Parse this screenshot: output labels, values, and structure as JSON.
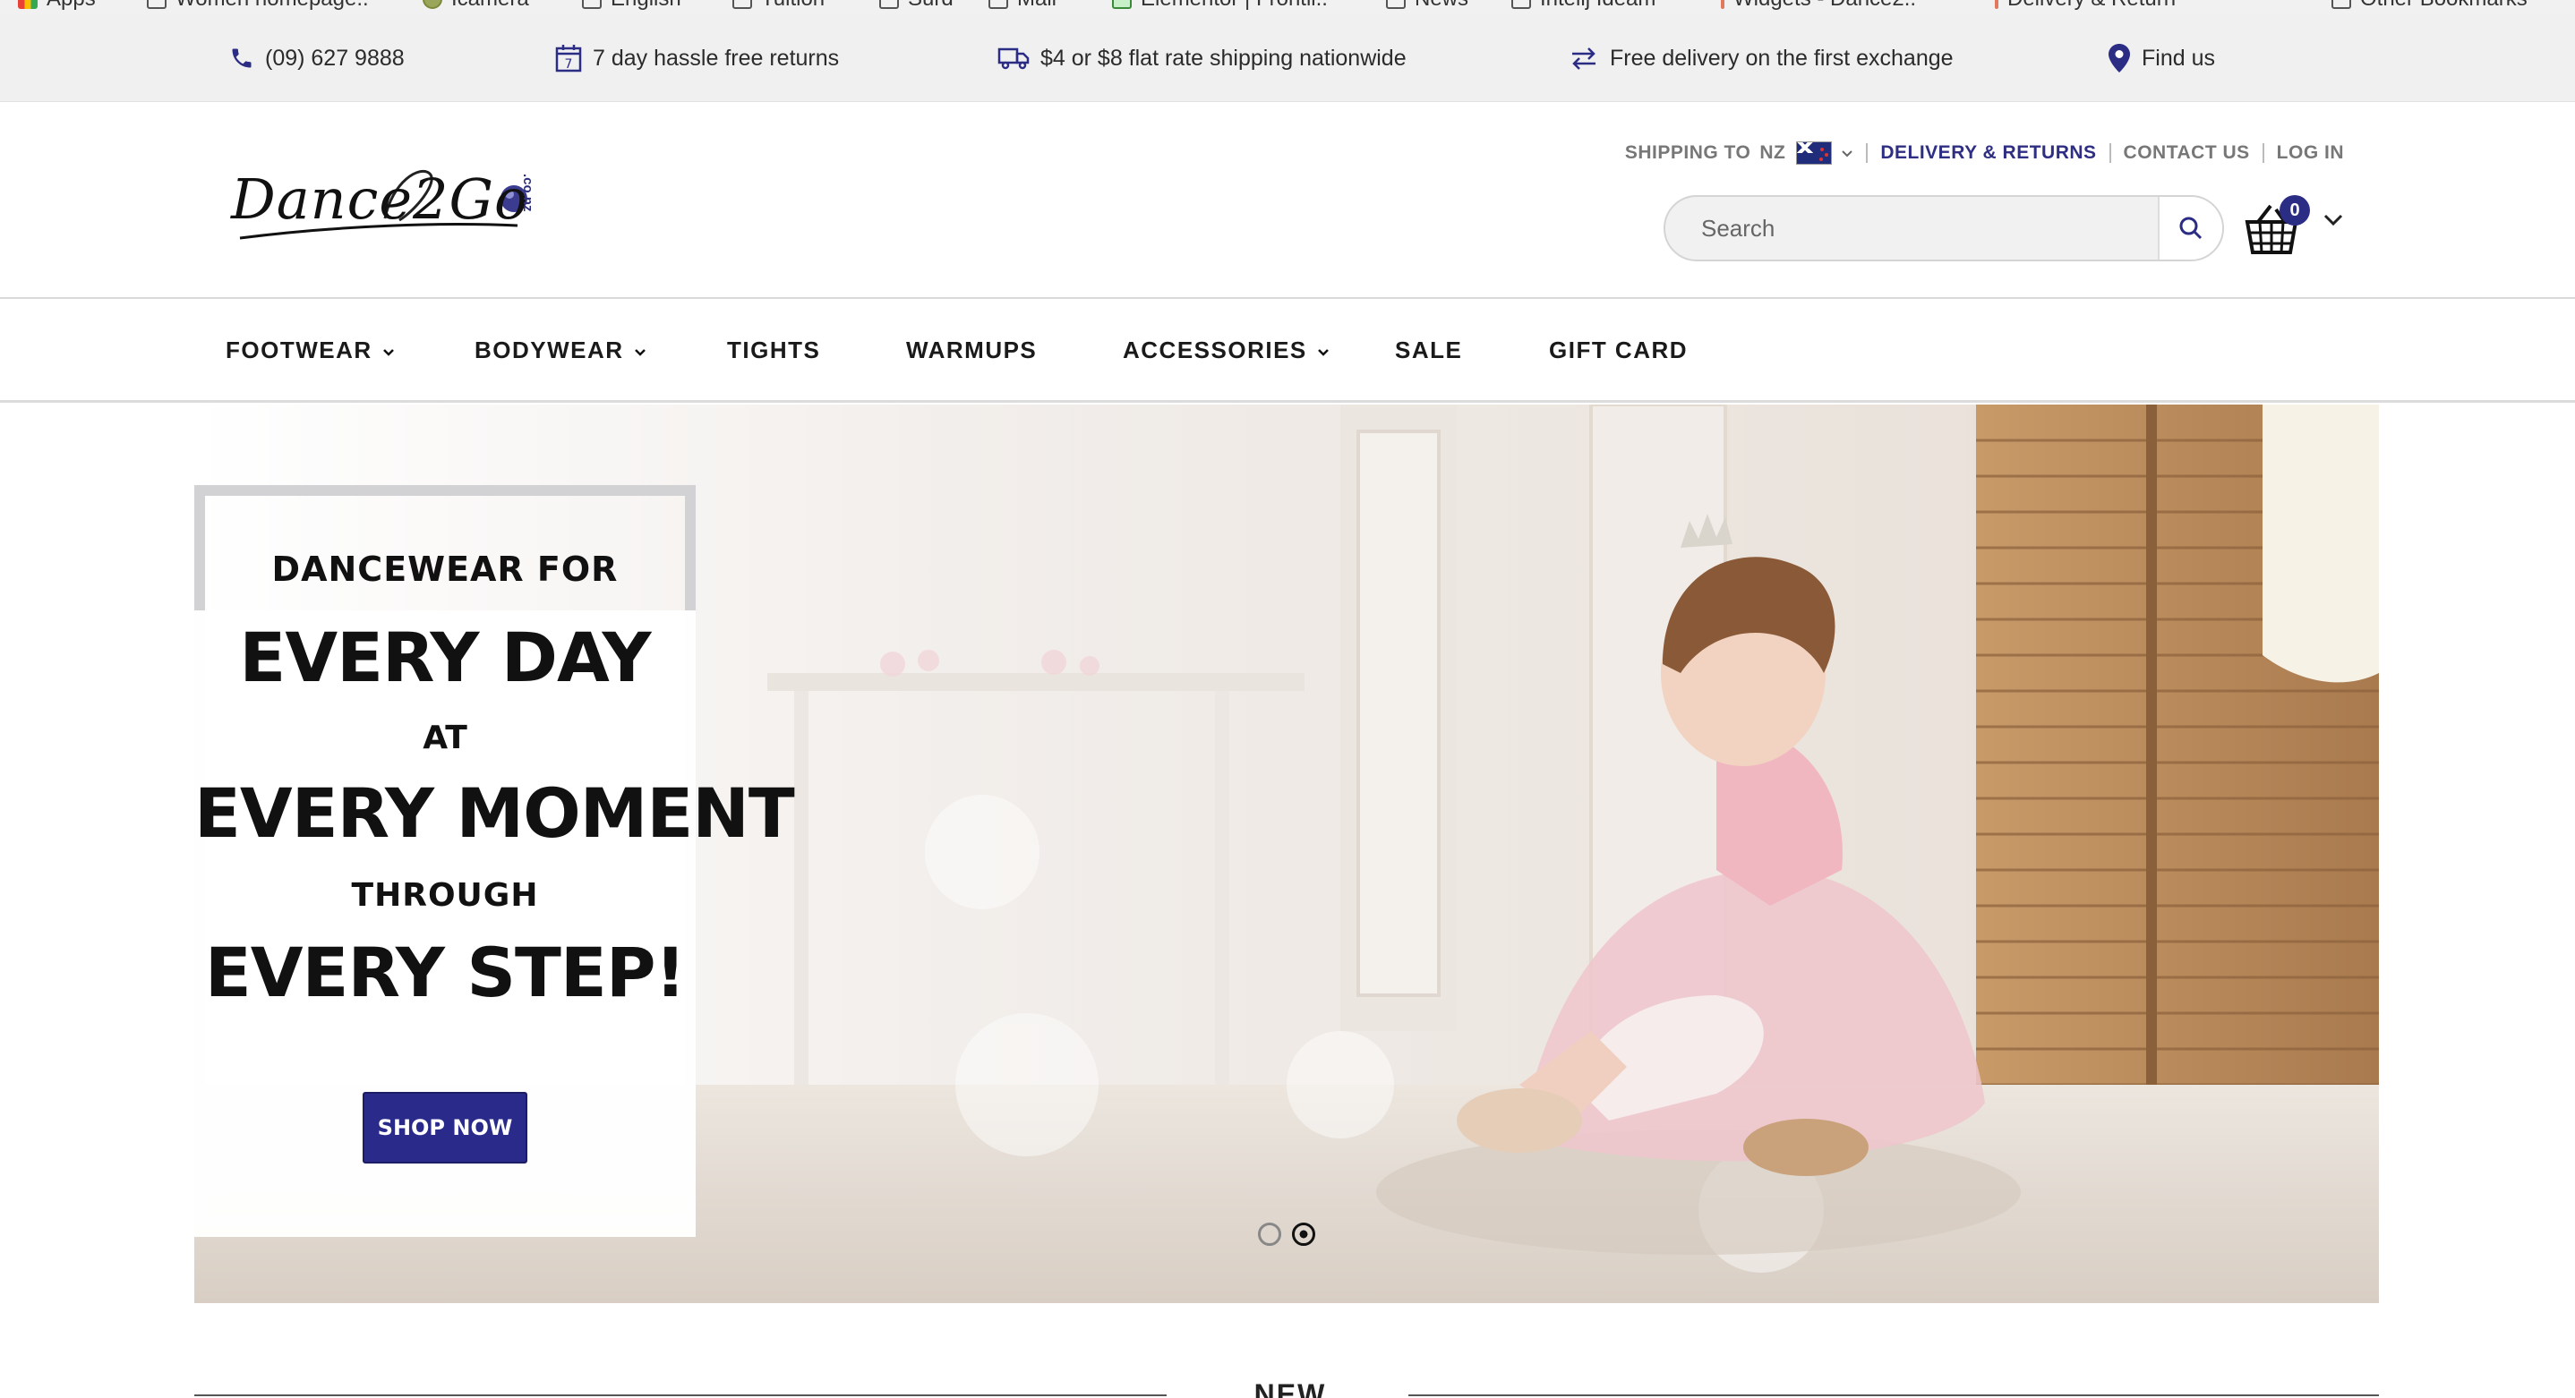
{
  "bookmarks": [
    {
      "label": "Apps",
      "icon": "apps-icon"
    },
    {
      "label": "Women homepage..",
      "icon": "page-icon"
    },
    {
      "label": "Icamera",
      "icon": "globe-icon"
    },
    {
      "label": "English",
      "icon": "folder-icon"
    },
    {
      "label": "Tuition",
      "icon": "folder-icon"
    },
    {
      "label": "Surd",
      "icon": "folder-icon"
    },
    {
      "label": "Mail",
      "icon": "folder-icon"
    },
    {
      "label": "Elementor | Frontli..",
      "icon": "elementor-icon"
    },
    {
      "label": "News",
      "icon": "folder-icon"
    },
    {
      "label": "Intelij Ideam",
      "icon": "folder-icon"
    },
    {
      "label": "Widgets - Dance2..",
      "icon": "site-icon"
    },
    {
      "label": "Delivery & Return",
      "icon": "site-icon"
    },
    {
      "label": "Other Bookmarks",
      "icon": "folder-icon"
    }
  ],
  "announcements": {
    "phone": "(09) 627 9888",
    "returns": "7 day hassle free returns",
    "shipping": "$4 or $8 flat rate shipping nationwide",
    "exchange": "Free delivery on the first exchange",
    "find_us": "Find us"
  },
  "header": {
    "logo_text": "Dance2Go",
    "logo_tld": ".co.nz",
    "shipping_to_label": "SHIPPING TO",
    "country": "NZ",
    "delivery_returns": "DELIVERY & RETURNS",
    "contact_us": "CONTACT US",
    "log_in": "LOG IN",
    "search_placeholder": "Search",
    "cart_count": "0"
  },
  "nav": {
    "footwear": "FOOTWEAR",
    "bodywear": "BODYWEAR",
    "tights": "TIGHTS",
    "warmups": "WARMUPS",
    "accessories": "ACCESSORIES",
    "sale": "SALE",
    "gift_card": "GIFT CARD"
  },
  "hero": {
    "line1": "DANCEWEAR FOR",
    "line2": "EVERY DAY",
    "line3": "AT",
    "line4": "EVERY MOMENT",
    "line5": "THROUGH",
    "line6": "EVERY STEP!",
    "cta": "SHOP NOW",
    "slides": 2,
    "active_slide": 2
  },
  "sections": {
    "new_arrivals": "NEW ARRIVALS"
  },
  "colors": {
    "accent": "#2b2d85",
    "topbar_bg": "#f0f0f0",
    "text": "#222222"
  }
}
